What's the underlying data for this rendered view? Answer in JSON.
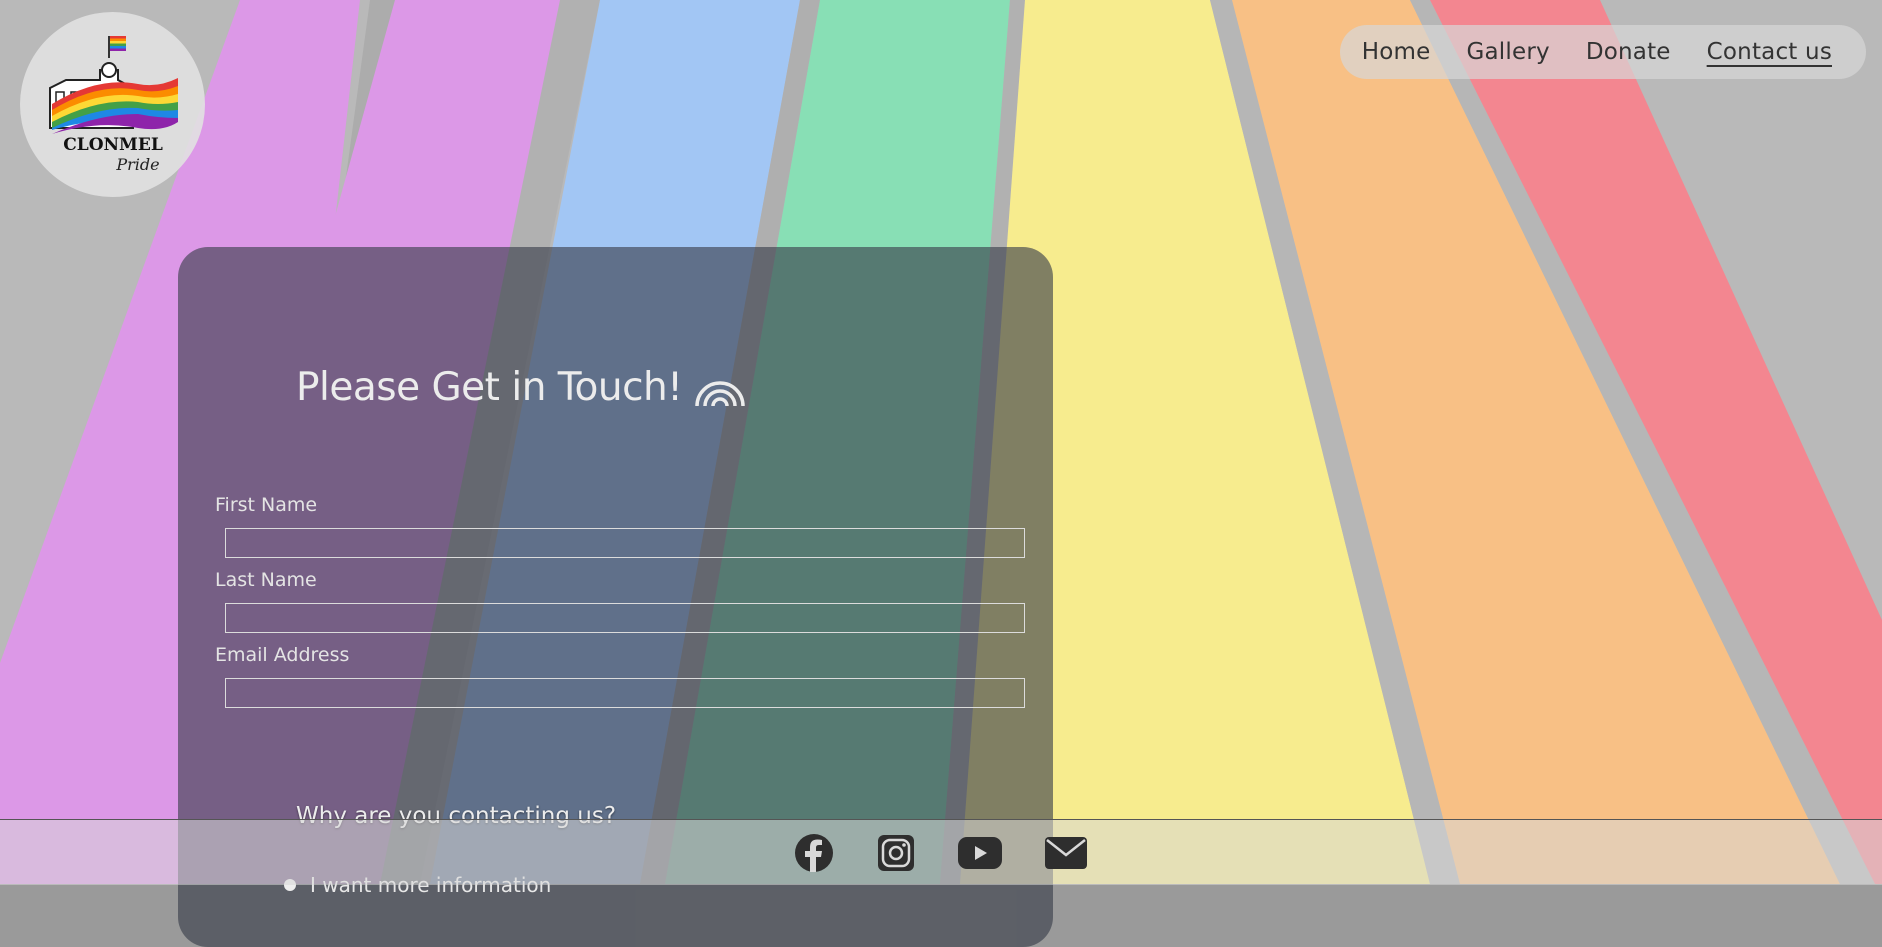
{
  "logo": {
    "text": "CLONMEL",
    "script_text": "Pride"
  },
  "nav": {
    "items": [
      {
        "label": "Home",
        "active": false
      },
      {
        "label": "Gallery",
        "active": false
      },
      {
        "label": "Donate",
        "active": false
      },
      {
        "label": "Contact us",
        "active": true
      }
    ]
  },
  "form": {
    "title": "Please Get in Touch!",
    "title_icon": "rainbow-icon",
    "fields": [
      {
        "label": "First Name",
        "value": "",
        "placeholder": ""
      },
      {
        "label": "Last Name",
        "value": "",
        "placeholder": ""
      },
      {
        "label": "Email Address",
        "value": "",
        "placeholder": ""
      }
    ],
    "why_title": "Why are you contacting us?",
    "options": [
      {
        "label": "I want more information"
      }
    ]
  },
  "footer": {
    "icons": [
      "facebook-icon",
      "instagram-icon",
      "youtube-icon",
      "email-icon"
    ]
  },
  "colors": {
    "card_bg": "#373c48",
    "nav_bg": "#d7d7d7",
    "text_light": "#ececec"
  }
}
